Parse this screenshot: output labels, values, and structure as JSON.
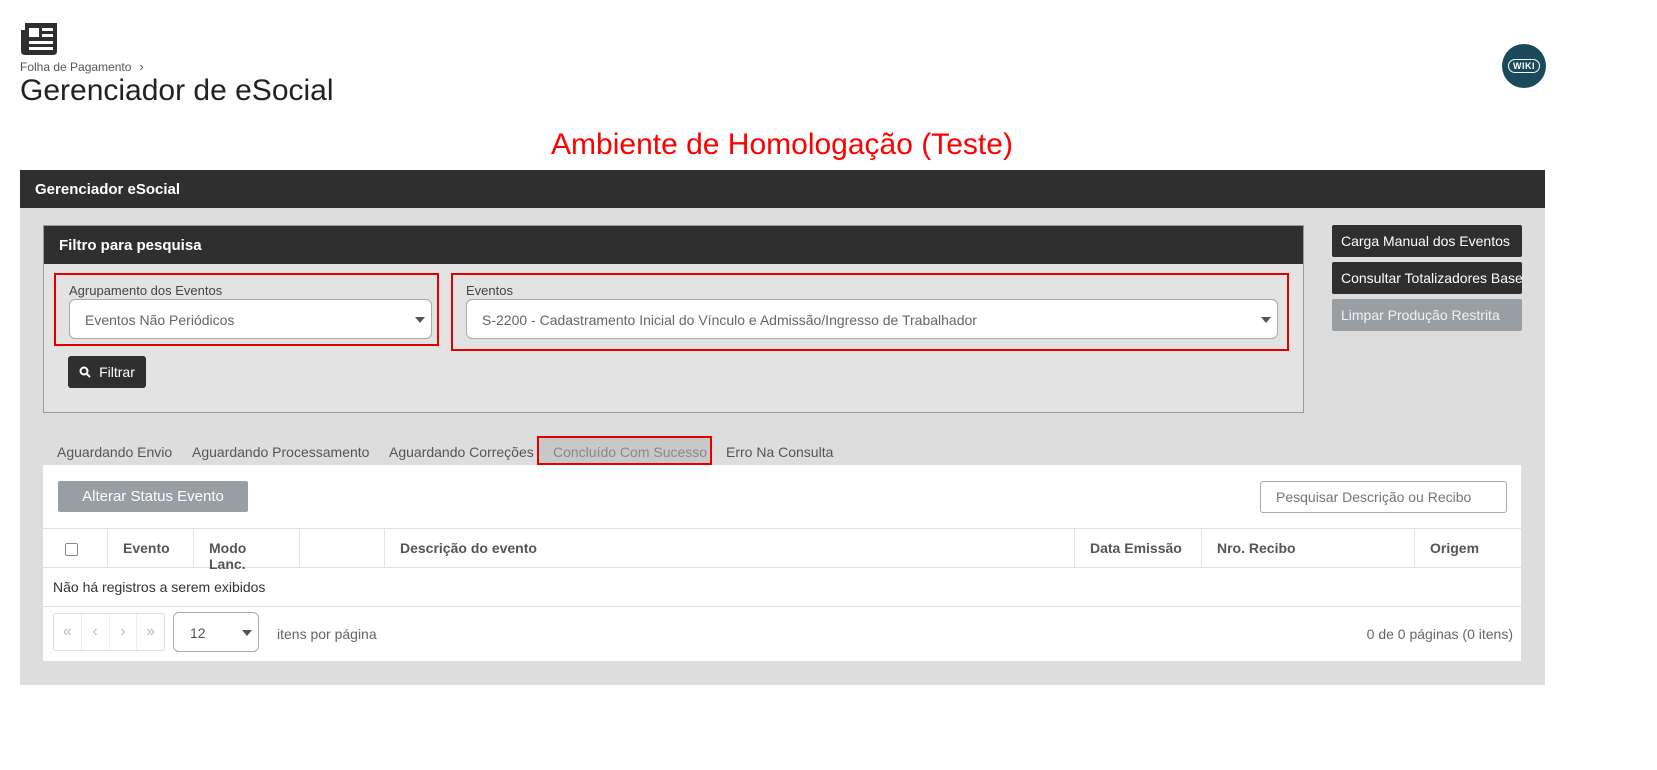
{
  "header": {
    "breadcrumb": "Folha de Pagamento",
    "title": "Gerenciador de eSocial",
    "wiki_label": "WIKI"
  },
  "environment_banner": "Ambiente de Homologação (Teste)",
  "panel": {
    "title": "Gerenciador eSocial"
  },
  "filter": {
    "title": "Filtro para pesquisa",
    "grouping_label": "Agrupamento dos Eventos",
    "grouping_value": "Eventos Não Periódicos",
    "events_label": "Eventos",
    "events_value": "S-2200 - Cadastramento Inicial do Vínculo e Admissão/Ingresso de Trabalhador",
    "filter_button": "Filtrar"
  },
  "side_buttons": {
    "manual_load": "Carga Manual dos Eventos",
    "totalizers": "Consultar Totalizadores Base",
    "clear_restricted": "Limpar Produção Restrita"
  },
  "tabs": {
    "waiting_send": "Aguardando Envio",
    "waiting_processing": "Aguardando Processamento",
    "waiting_corrections": "Aguardando Correções",
    "success": "Concluído Com Sucesso",
    "query_error": "Erro Na Consulta"
  },
  "grid": {
    "alter_status_button": "Alterar Status Evento",
    "search_placeholder": "Pesquisar Descrição ou Recibo",
    "columns": {
      "event": "Evento",
      "mode": "Modo Lanc.",
      "blank": "",
      "description": "Descrição do evento",
      "issue_date": "Data Emissão",
      "receipt": "Nro. Recibo",
      "origin": "Origem"
    },
    "empty_message": "Não há registros a serem exibidos",
    "page_size": "12",
    "per_page_label": "itens por página",
    "page_info": "0 de 0 páginas (0 itens)"
  }
}
